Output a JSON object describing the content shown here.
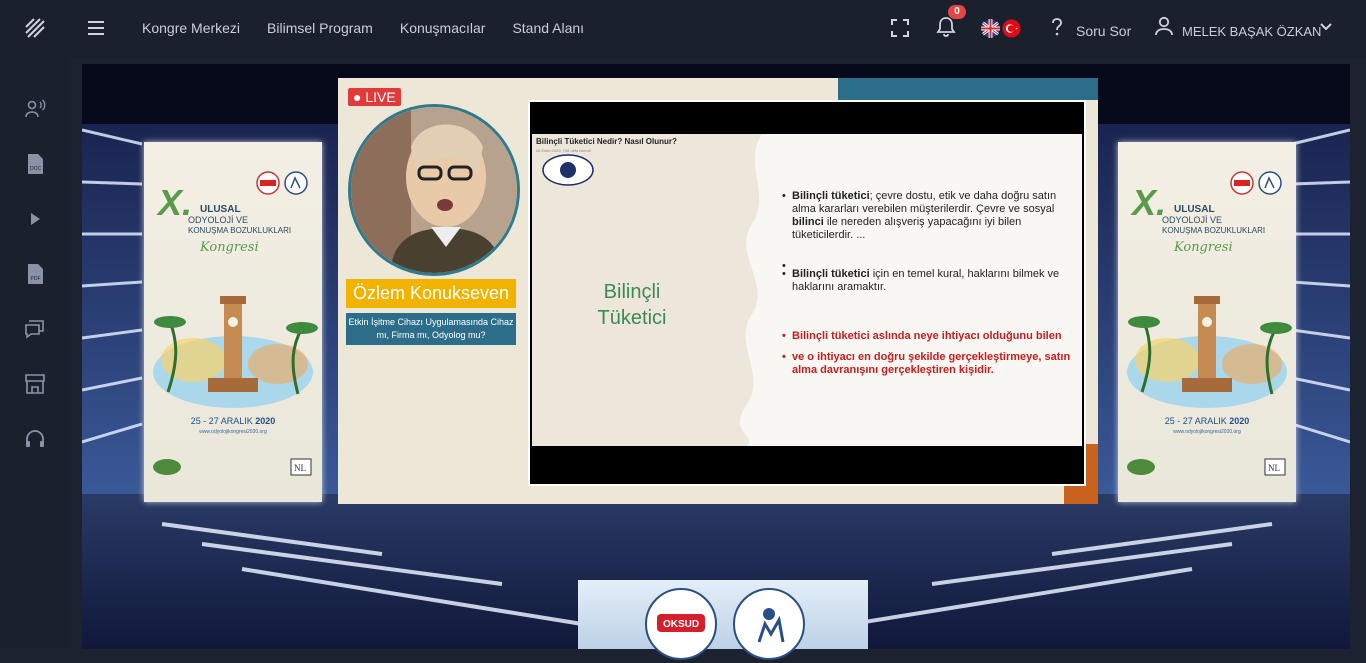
{
  "nav": {
    "items": [
      "Kongre Merkezi",
      "Bilimsel Program",
      "Konuşmacılar",
      "Stand Alanı"
    ]
  },
  "header": {
    "notifications_count": "0",
    "ask_label": "Soru Sor",
    "user_name": "MELEK BAŞAK ÖZKAN"
  },
  "sidebar": {
    "items": [
      "audio-icon",
      "doc-icon",
      "play-icon",
      "pdf-icon",
      "chat-icon",
      "booth-icon",
      "headset-icon"
    ]
  },
  "banner": {
    "numeral": "X.",
    "ulusal": "ULUSAL",
    "line2": "ODYOLOJİ VE",
    "line3": "KONUŞMA BOZUKLUKLARI",
    "kongre": "Kongresi",
    "dates_prefix": "25 - 27 ARALIK ",
    "dates_year": "2020",
    "url": "www.odyolojikongresi2020.org"
  },
  "video": {
    "live_label": "LIVE",
    "speaker_name": "Özlem Konukseven",
    "speaker_topic": "Etkin İşitme Cihazı Uygulamasında Cihaz mı, Firma mı, Odyolog mu?"
  },
  "slide": {
    "header": "Bilinçli Tüketici Nedir? Nasıl Olunur?",
    "subheader": "26 Ekim 2020, 708 defa izlendi",
    "title_line1": "Bilinçli",
    "title_line2": "Tüketici",
    "bullet1_bold": "Bilinçli tüketici",
    "bullet1_text": "; çevre dostu, etik ve daha doğru satın alma kararları verebilen müşterilerdir. Çevre ve sosyal ",
    "bullet1_bold2": "bilinci",
    "bullet1_text2": " ile nereden alışveriş yapacağını iyi bilen tüketicilerdir. ...",
    "bullet3_bold": "Bilinçli tüketici",
    "bullet3_text": " için en temel kural, haklarını bilmek ve haklarını aramaktır.",
    "red1": "Bilinçli tüketici aslında neye ihtiyacı olduğunu bilen",
    "red2": "ve o ihtiyacı en doğru şekilde gerçekleştirmeye, satın alma davranışını gerçekleştiren kişidir."
  },
  "podium": {
    "oksud": "OKSUD"
  },
  "colors": {
    "accent": "#f2b200",
    "live": "#e03a3a",
    "badge": "#e54545",
    "topic_bg": "#2c6e8a"
  }
}
